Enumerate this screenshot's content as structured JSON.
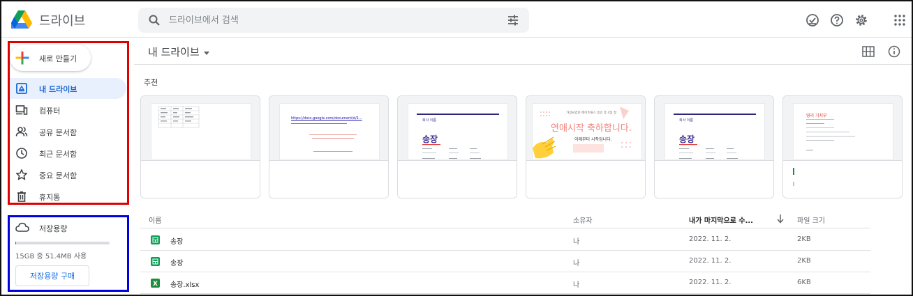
{
  "header": {
    "app_title": "드라이브",
    "search_placeholder": "드라이브에서 검색"
  },
  "sidebar": {
    "new_button": "새로 만들기",
    "items": [
      {
        "label": "내 드라이브",
        "icon": "my-drive-icon",
        "active": true
      },
      {
        "label": "컴퓨터",
        "icon": "computer-icon"
      },
      {
        "label": "공유 문서함",
        "icon": "shared-icon"
      },
      {
        "label": "최근 문서함",
        "icon": "recent-icon"
      },
      {
        "label": "중요 문서함",
        "icon": "star-icon"
      },
      {
        "label": "휴지통",
        "icon": "trash-icon"
      }
    ],
    "storage": {
      "label": "저장용량",
      "usage_text": "15GB 중 51.4MB 사용",
      "used_fraction": 0.0034,
      "buy_button": "저장용량 구매"
    }
  },
  "main": {
    "title": "내 드라이브",
    "suggested_label": "추천",
    "cards": [
      {
        "kind": "sheet-table"
      },
      {
        "kind": "doc-link",
        "url_text": "https://docs.google.com/document/d/1..."
      },
      {
        "kind": "invoice",
        "header_text": "회사 이름",
        "title": "송장"
      },
      {
        "kind": "greeting",
        "top_text": "가장되었던 메이트원스 승인 후 4일 정",
        "headline": "연애시작 축하합니다.",
        "subline": "이제부터 시작입니다."
      },
      {
        "kind": "invoice",
        "header_text": "회사 이름",
        "title": "송장"
      },
      {
        "kind": "notes",
        "title": "영리 기지부"
      }
    ],
    "columns": {
      "name": "이름",
      "owner": "소유자",
      "modified": "내가 마지막으로 수...",
      "size": "파일 크기"
    },
    "files": [
      {
        "name": "송장",
        "type": "sheets",
        "owner": "나",
        "modified": "2022. 11. 2.",
        "size": "2KB"
      },
      {
        "name": "송장",
        "type": "sheets",
        "owner": "나",
        "modified": "2022. 11. 2.",
        "size": "2KB"
      },
      {
        "name": "송장.xlsx",
        "type": "excel",
        "owner": "나",
        "modified": "2022. 11. 2.",
        "size": "6KB"
      }
    ]
  },
  "colors": {
    "sheets": "#0f9d58",
    "excel": "#1e8e3e",
    "accent": "#1a73e8",
    "active_bg": "#e8f0fe",
    "annotation_red": "#e00000",
    "annotation_blue": "#0000e0"
  }
}
